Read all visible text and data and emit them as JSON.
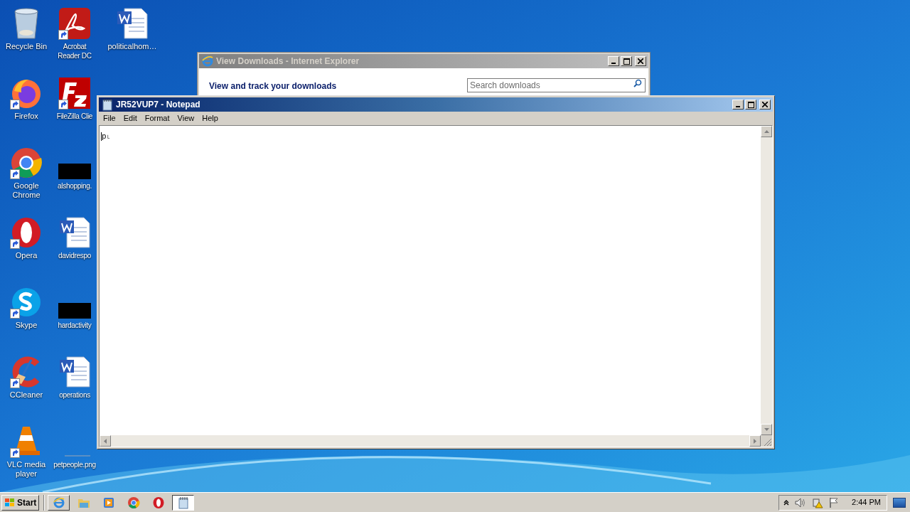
{
  "desktop_icons": [
    {
      "label": "Recycle Bin",
      "kind": "recycle",
      "shortcut": false
    },
    {
      "label": "Firefox",
      "kind": "firefox",
      "shortcut": true
    },
    {
      "label": "Google Chrome",
      "kind": "chrome",
      "shortcut": true
    },
    {
      "label": "Opera",
      "kind": "opera",
      "shortcut": true
    },
    {
      "label": "Skype",
      "kind": "skype",
      "shortcut": true
    },
    {
      "label": "CCleaner",
      "kind": "ccleaner",
      "shortcut": true
    },
    {
      "label": "VLC media player",
      "kind": "vlc",
      "shortcut": true
    },
    {
      "label": "Acrobat Reader DC",
      "kind": "pdf",
      "shortcut": true
    },
    {
      "label": "FileZilla Clie",
      "kind": "filezilla",
      "shortcut": true
    },
    {
      "label": "alshopping.",
      "kind": "redacted",
      "shortcut": false
    },
    {
      "label": "davidrespo",
      "kind": "word",
      "shortcut": false
    },
    {
      "label": "hardactivity",
      "kind": "redacted",
      "shortcut": false
    },
    {
      "label": "operations",
      "kind": "word",
      "shortcut": false
    },
    {
      "label": "petpeople.png",
      "kind": "image",
      "shortcut": false
    },
    {
      "label": "politicalhom…",
      "kind": "word",
      "shortcut": false
    }
  ],
  "ie_window": {
    "title": "View Downloads - Internet Explorer",
    "active": false,
    "heading": "View and track your downloads",
    "search": {
      "placeholder": "Search downloads"
    }
  },
  "notepad": {
    "title": "JR52VUP7 - Notepad",
    "active": true,
    "menu": [
      "File",
      "Edit",
      "Format",
      "View",
      "Help"
    ],
    "text": "p˪"
  },
  "taskbar": {
    "start": "Start",
    "items": [
      {
        "kind": "ie",
        "selected": false
      },
      {
        "kind": "folder",
        "selected": false
      },
      {
        "kind": "media",
        "selected": false
      },
      {
        "kind": "chrome",
        "selected": false
      },
      {
        "kind": "opera",
        "selected": false
      },
      {
        "kind": "notepad",
        "selected": true
      }
    ],
    "clock": "2:44 PM"
  }
}
